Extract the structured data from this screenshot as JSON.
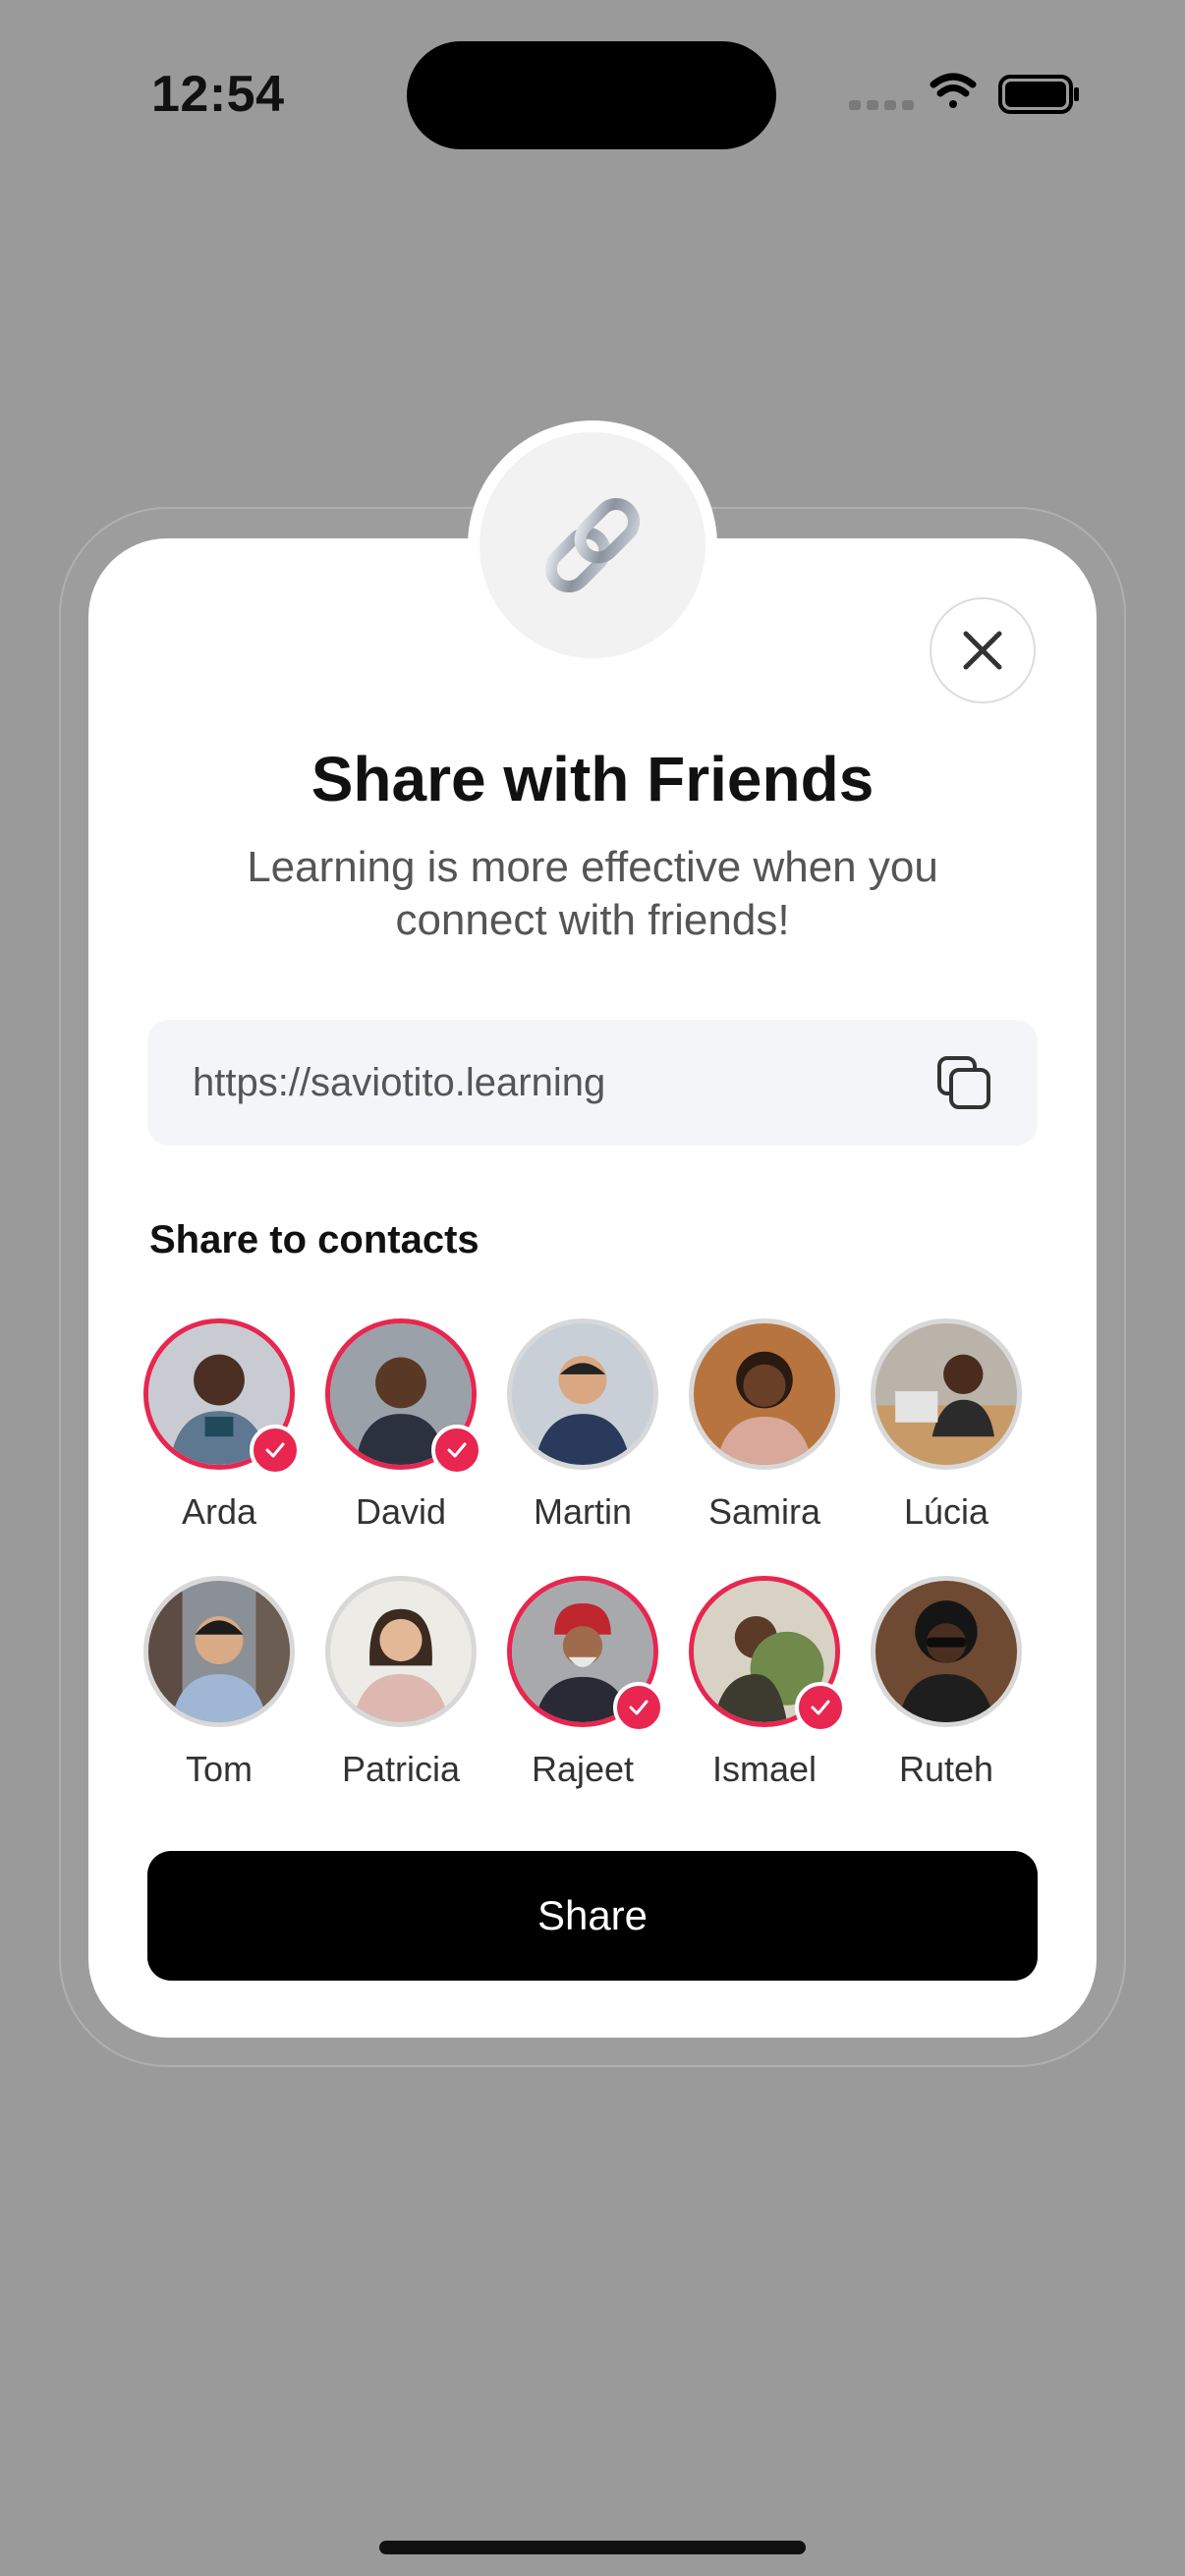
{
  "status_bar": {
    "time": "12:54"
  },
  "dialog": {
    "title": "Share with Friends",
    "subtitle": "Learning is more effective when you connect with friends!",
    "link_icon": "link-chain-icon",
    "close_icon": "close-icon",
    "url": {
      "value": "https://saviotito.learning",
      "copy_icon": "copy-icon"
    },
    "contacts_section_label": "Share to contacts",
    "contacts": [
      {
        "name": "Arda",
        "selected": true
      },
      {
        "name": "David",
        "selected": true
      },
      {
        "name": "Martin",
        "selected": false
      },
      {
        "name": "Samira",
        "selected": false
      },
      {
        "name": "Lúcia",
        "selected": false
      },
      {
        "name": "Tom",
        "selected": false
      },
      {
        "name": "Patricia",
        "selected": false
      },
      {
        "name": "Rajeet",
        "selected": true
      },
      {
        "name": "Ismael",
        "selected": true
      },
      {
        "name": "Ruteh",
        "selected": false
      }
    ],
    "share_button_label": "Share"
  },
  "colors": {
    "accent": "#e8264f",
    "button": "#000000",
    "backdrop": "#9a9a9a"
  }
}
